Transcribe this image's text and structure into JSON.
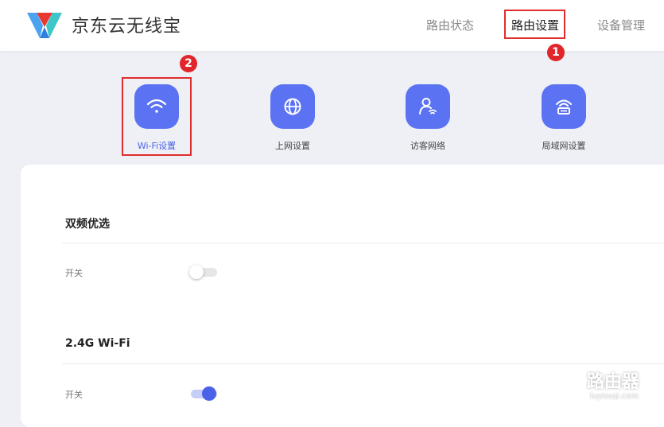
{
  "header": {
    "app_title": "京东云无线宝",
    "nav": {
      "status": "路由状态",
      "settings": "路由设置",
      "devices": "设备管理"
    }
  },
  "annotations": {
    "step1": "1",
    "step2": "2",
    "highlight_color": "#e02d2d"
  },
  "icon_tabs": [
    {
      "label": "Wi-Fi设置",
      "icon": "wifi-icon",
      "active": true
    },
    {
      "label": "上网设置",
      "icon": "globe-icon",
      "active": false
    },
    {
      "label": "访客网络",
      "icon": "guest-icon",
      "active": false
    },
    {
      "label": "局域网设置",
      "icon": "router-icon",
      "active": false
    }
  ],
  "sections": [
    {
      "title": "双频优选",
      "switch_label": "开关",
      "enabled": false
    },
    {
      "title": "2.4G Wi-Fi",
      "switch_label": "开关",
      "enabled": true
    }
  ],
  "watermark": {
    "title": "路由器",
    "url": "luyouqi.com"
  },
  "colors": {
    "accent": "#5b73f2",
    "active_text": "#4a62e8"
  }
}
